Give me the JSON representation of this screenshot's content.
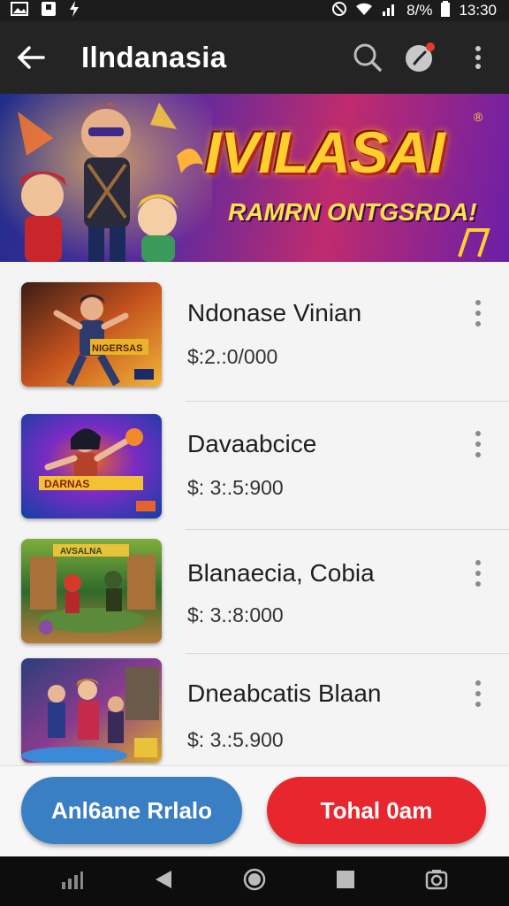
{
  "status_bar": {
    "battery": "8/%",
    "time": "13:30"
  },
  "app_bar": {
    "title": "Ilndanasia"
  },
  "banner": {
    "title": "IVILASAI",
    "subtitle": "RAMRN ONTGSRDA!",
    "badge": "®"
  },
  "items": [
    {
      "title": "Ndonase Vinian",
      "price": "$:2.:0/000",
      "thumb_colors": [
        "#3b1d16",
        "#c4521e",
        "#f2b437"
      ],
      "thumb_label": "NIGERSAS"
    },
    {
      "title": "Davaabcice",
      "price": "$: 3:.5:900",
      "thumb_colors": [
        "#1b3fa8",
        "#7b2bc4",
        "#e8612a"
      ],
      "thumb_label": "DARNAS"
    },
    {
      "title": "Blanaecia, Cobia",
      "price": "$: 3.:8:000",
      "thumb_colors": [
        "#2f6b2c",
        "#7fae3c",
        "#b37a3a"
      ],
      "thumb_label": "AVSALNA"
    },
    {
      "title": "Dneabcatis Blaan",
      "price": "$: 3.:5.900",
      "thumb_colors": [
        "#2a3f7a",
        "#8a3b8f",
        "#d9a72b"
      ],
      "thumb_label": ""
    }
  ],
  "buttons": {
    "primary": "Anl6ane Rrlalo",
    "secondary": "Tohal 0am"
  },
  "colors": {
    "primary_button": "#3a7ec4",
    "secondary_button": "#e8262d",
    "app_bar": "#242424"
  }
}
